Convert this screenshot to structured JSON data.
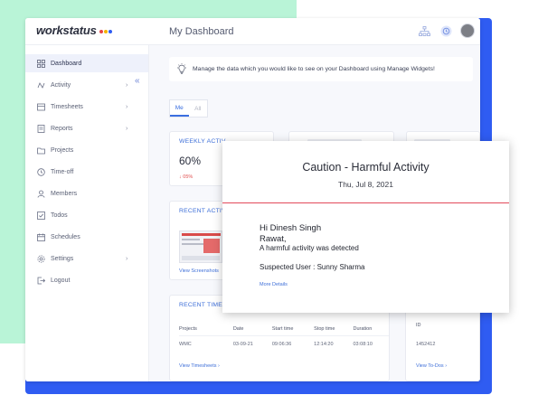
{
  "app": {
    "brand": "workstatus",
    "brand_dot_colors": [
      "#e84545",
      "#f4b400",
      "#2f5cf2"
    ],
    "page_title": "My Dashboard"
  },
  "sidebar": {
    "items": [
      {
        "label": "Dashboard",
        "icon": "grid-icon",
        "active": true,
        "chevron": false
      },
      {
        "label": "Activity",
        "icon": "activity-icon",
        "chevron": true
      },
      {
        "label": "Timesheets",
        "icon": "timesheet-icon",
        "chevron": true
      },
      {
        "label": "Reports",
        "icon": "report-icon",
        "chevron": true
      },
      {
        "label": "Projects",
        "icon": "folder-icon",
        "chevron": false
      },
      {
        "label": "Time-off",
        "icon": "clock-icon",
        "chevron": false
      },
      {
        "label": "Members",
        "icon": "user-icon",
        "chevron": false
      },
      {
        "label": "Todos",
        "icon": "todo-icon",
        "chevron": false
      },
      {
        "label": "Schedules",
        "icon": "calendar-icon",
        "chevron": false
      },
      {
        "label": "Settings",
        "icon": "gear-icon",
        "chevron": true
      },
      {
        "label": "Logout",
        "icon": "logout-icon",
        "chevron": false
      }
    ]
  },
  "banner": {
    "text": "Manage the data which you would like to see on your Dashboard using Manage Widgets!"
  },
  "scope_tabs": {
    "me": "Me",
    "all": "All"
  },
  "weekly_activity": {
    "title": "WEEKLY ACTIV",
    "value": "60%",
    "delta": "↓ 05%"
  },
  "recent_activity": {
    "title": "RECENT ACTIV",
    "link": "View Screenshots"
  },
  "recent_timesheets": {
    "title": "RECENT TIMES",
    "columns": [
      "Projects",
      "Date",
      "Start time",
      "Stop time",
      "Duration"
    ],
    "rows": [
      [
        "WMC",
        "03-09-21",
        "09:06:36",
        "12:14:20",
        "03:08:10"
      ]
    ],
    "link": "View Timesheets ›"
  },
  "todos": {
    "column": "ID",
    "value": "1452412",
    "link": "View To-Dos ›"
  },
  "modal": {
    "title": "Caution - Harmful Activity",
    "date": "Thu, Jul 8, 2021",
    "greeting": "Hi Dinesh Singh",
    "greeting_cont": "Rawat,",
    "message": "A harmful activity was detected",
    "suspect": "Suspected User : Sunny Sharma",
    "link": "More Details"
  }
}
